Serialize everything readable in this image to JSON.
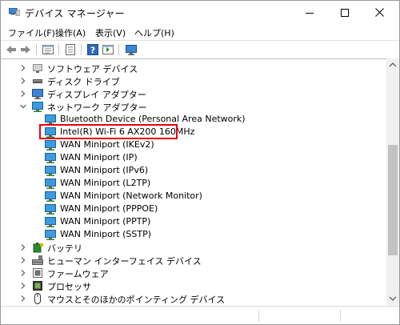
{
  "window": {
    "title": "デバイス マネージャー"
  },
  "menu": [
    {
      "label": "ファイル(F)"
    },
    {
      "label": "操作(A)"
    },
    {
      "label": "表示(V)"
    },
    {
      "label": "ヘルプ(H)"
    }
  ],
  "toolbar": {
    "buttons": [
      "back-arrow-icon",
      "forward-arrow-icon",
      "device-view-icon",
      "properties-icon",
      "help-icon",
      "update-driver-icon",
      "monitor-scan-icon"
    ]
  },
  "tree": {
    "categories_top": [
      {
        "label": "ソフトウェア デバイス",
        "icon": "software-device-icon",
        "expanded": false
      },
      {
        "label": "ディスク ドライブ",
        "icon": "disk-drive-icon",
        "expanded": false
      },
      {
        "label": "ディスプレイ アダプター",
        "icon": "display-adapter-icon",
        "expanded": false
      },
      {
        "label": "ネットワーク アダプター",
        "icon": "network-adapter-icon",
        "expanded": true
      }
    ],
    "network_adapters": [
      {
        "label": "Bluetooth Device (Personal Area Network)"
      },
      {
        "label": "Intel(R) Wi-Fi 6 AX200 160MHz",
        "highlighted": true
      },
      {
        "label": "WAN Miniport (IKEv2)"
      },
      {
        "label": "WAN Miniport (IP)"
      },
      {
        "label": "WAN Miniport (IPv6)"
      },
      {
        "label": "WAN Miniport (L2TP)"
      },
      {
        "label": "WAN Miniport (Network Monitor)"
      },
      {
        "label": "WAN Miniport (PPPOE)"
      },
      {
        "label": "WAN Miniport (PPTP)"
      },
      {
        "label": "WAN Miniport (SSTP)"
      }
    ],
    "categories_bottom": [
      {
        "label": "バッテリ",
        "icon": "battery-icon",
        "expanded": false
      },
      {
        "label": "ヒューマン インターフェイス デバイス",
        "icon": "hid-icon",
        "expanded": false
      },
      {
        "label": "ファームウェア",
        "icon": "firmware-icon",
        "expanded": false
      },
      {
        "label": "プロセッサ",
        "icon": "processor-icon",
        "expanded": false
      },
      {
        "label": "マウスとそのほかのポインティング デバイス",
        "icon": "mouse-icon",
        "expanded": false
      }
    ]
  },
  "colors": {
    "highlight_border": "#e60012",
    "network_icon": "#2f8fd8"
  }
}
